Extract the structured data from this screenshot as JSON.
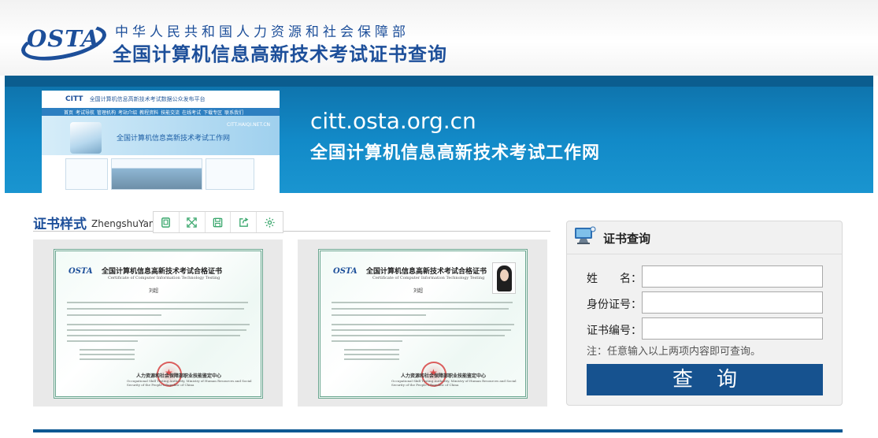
{
  "header": {
    "logo_text": "OSTA",
    "org_name": "中华人民共和国人力资源和社会保障部",
    "site_title": "全国计算机信息高新技术考试证书查询"
  },
  "banner": {
    "url": "citt.osta.org.cn",
    "tagline": "全国计算机信息高新技术考试工作网",
    "screenshot": {
      "brand": "CITT",
      "top_text": "全国计算机信息高新技术考试数据公众发布平台",
      "nav": [
        "首页",
        "考试导航",
        "管理机构",
        "考站介绍",
        "教程资料",
        "技能交流",
        "在线考试",
        "下载专区",
        "联系我们"
      ],
      "site": "CITT.HAIQI.NET.CN",
      "hero_title": "全国计算机信息高新技术考试工作网"
    }
  },
  "samples": {
    "title": "证书样式",
    "subtitle": "ZhengshuYang",
    "toolbar": [
      "copy-icon",
      "fullscreen-icon",
      "save-icon",
      "share-icon",
      "settings-icon"
    ],
    "certificates": [
      {
        "logo": "OSTA",
        "title": "全国计算机信息高新技术考试合格证书",
        "subtitle": "Certificate of Computer Information Technology Testing",
        "name": "刘超",
        "org": "人力资源和社会保障部职业技能鉴定中心",
        "org_en": "Occupational Skill Testing Authority, Ministry of Human Resources and Social Security of the People's Republic of China",
        "has_photo": false
      },
      {
        "logo": "OSTA",
        "title": "全国计算机信息高新技术考试合格证书",
        "subtitle": "Certificate of Computer Information Technology Testing",
        "name": "刘超",
        "org": "人力资源和社会保障部职业技能鉴定中心",
        "org_en": "Occupational Skill Testing Authority, Ministry of Human Resources and Social Security of the People's Republic of China",
        "has_photo": true
      }
    ]
  },
  "query": {
    "title": "证书查询",
    "fields": [
      {
        "label": "姓　　名：",
        "value": "",
        "placeholder": ""
      },
      {
        "label": "身份证号：",
        "value": "",
        "placeholder": ""
      },
      {
        "label": "证书编号：",
        "value": "",
        "placeholder": ""
      }
    ],
    "note": "注：任意输入以上两项内容即可查询。",
    "button": "查询"
  },
  "colors": {
    "brand_blue": "#1d4f9a",
    "banner_blue": "#128ac8",
    "button_blue": "#16528f",
    "icon_green": "#3aa76d"
  }
}
